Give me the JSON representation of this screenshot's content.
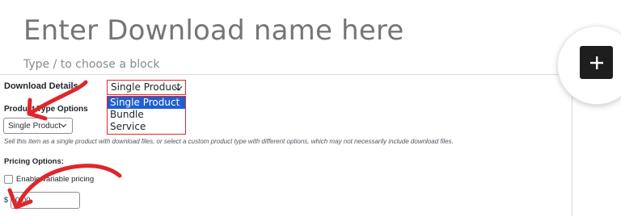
{
  "editor": {
    "title_placeholder": "Enter Download name here",
    "block_placeholder": "Type / to choose a block"
  },
  "download_details": {
    "heading": "Download Details",
    "selected": "Single Product",
    "options": [
      "Single Product",
      "Bundle",
      "Service"
    ],
    "highlighted_option": "Single Product"
  },
  "product_type": {
    "label": "Product Type Options",
    "selected": "Single Product",
    "description": "Sell this item as a single product with download files, or select a custom product type with different options, which may not necessarily include download files."
  },
  "pricing": {
    "heading": "Pricing Options:",
    "variable_label": "Enable variable pricing",
    "variable_checked": false,
    "currency_symbol": "$",
    "price_value": "0.00"
  },
  "inserter": {
    "icon": "plus-icon"
  },
  "annotation_arrows": {
    "color": "#e0262a",
    "icon": "arrow-annotation-icon"
  },
  "colors": {
    "highlight": "#1e5fd1",
    "annotation": "#e0262a",
    "inserter_bg": "#1e1e1e"
  }
}
